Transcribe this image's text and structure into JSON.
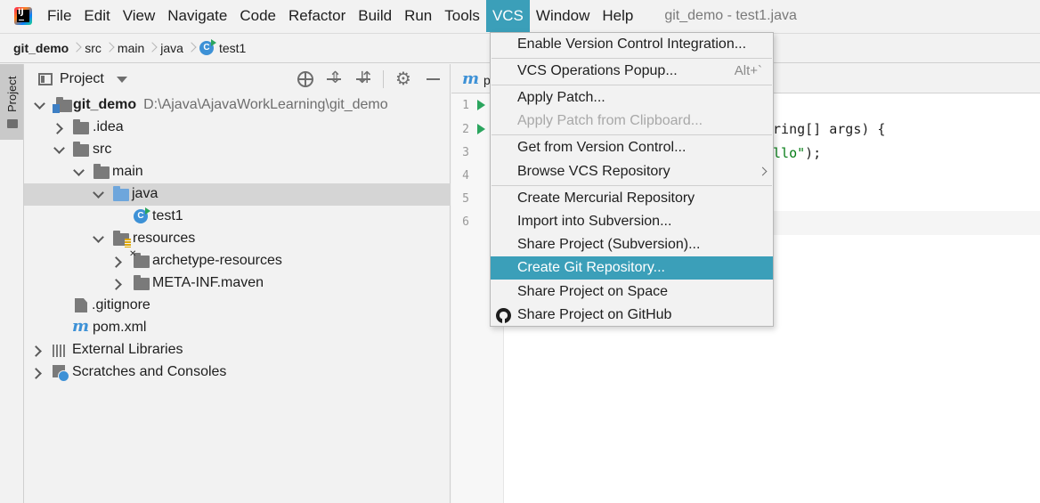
{
  "menubar": {
    "items": [
      "File",
      "Edit",
      "View",
      "Navigate",
      "Code",
      "Refactor",
      "Build",
      "Run",
      "Tools",
      "VCS",
      "Window",
      "Help"
    ],
    "active": "VCS",
    "window_title": "git_demo - test1.java"
  },
  "breadcrumbs": [
    "git_demo",
    "src",
    "main",
    "java",
    "test1"
  ],
  "tool_stripe": {
    "project_label": "Project"
  },
  "project_panel": {
    "title": "Project",
    "tree": [
      {
        "label": "git_demo",
        "path": "D:\\Ajava\\AjavaWorkLearning\\git_demo"
      },
      {
        "label": ".idea"
      },
      {
        "label": "src"
      },
      {
        "label": "main"
      },
      {
        "label": "java"
      },
      {
        "label": "test1"
      },
      {
        "label": "resources"
      },
      {
        "label": "archetype-resources"
      },
      {
        "label": "META-INF.maven"
      },
      {
        "label": ".gitignore"
      },
      {
        "label": "pom.xml"
      },
      {
        "label": "External Libraries"
      },
      {
        "label": "Scratches and Consoles"
      }
    ]
  },
  "editor": {
    "tab_label": "p",
    "line_numbers": [
      "1",
      "2",
      "3",
      "4",
      "5",
      "6"
    ],
    "code": {
      "line2_a": "tring[] args) {",
      "line3_str": "ello\"",
      "line3_b": ");"
    }
  },
  "vcs_menu": {
    "items": [
      {
        "label": "Enable Version Control Integration..."
      },
      {
        "label": "VCS Operations Popup...",
        "shortcut": "Alt+`"
      },
      {
        "label": "Apply Patch..."
      },
      {
        "label": "Apply Patch from Clipboard..."
      },
      {
        "label": "Get from Version Control..."
      },
      {
        "label": "Browse VCS Repository"
      },
      {
        "label": "Create Mercurial Repository"
      },
      {
        "label": "Import into Subversion..."
      },
      {
        "label": "Share Project (Subversion)..."
      },
      {
        "label": "Create Git Repository..."
      },
      {
        "label": "Share Project on Space"
      },
      {
        "label": "Share Project on GitHub"
      }
    ]
  }
}
